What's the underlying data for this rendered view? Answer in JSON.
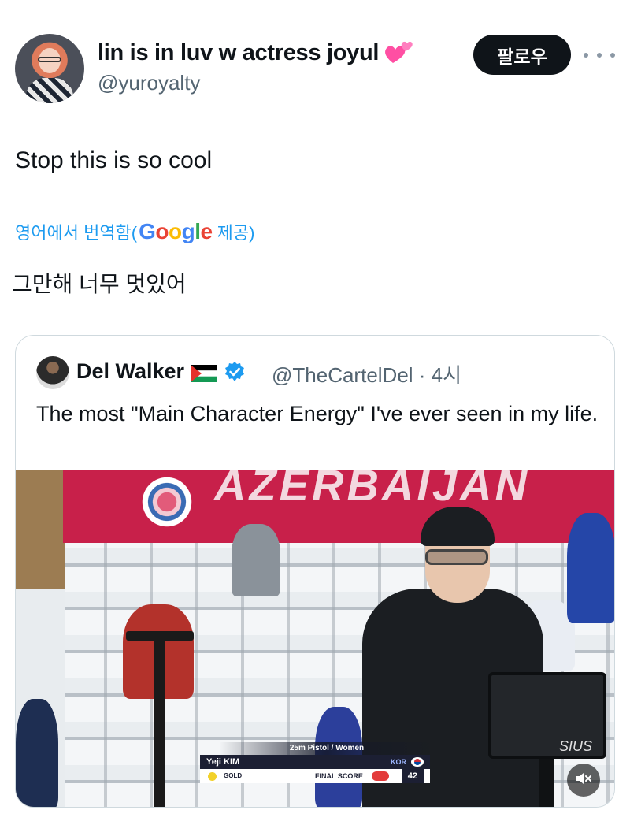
{
  "tweet": {
    "display_name": "lin is in luv w actress joyul",
    "handle": "@yuroyalty",
    "follow_label": "팔로우",
    "text": "Stop this is so cool",
    "translated_from": "영어에서 번역함(",
    "translation_provider": "Google",
    "translation_suffix": " 제공)",
    "translated_text": "그만해 너무 멋있어"
  },
  "quote": {
    "display_name": "Del Walker",
    "handle_time": "@TheCartelDel · 4시",
    "text": "The most \"Main Character Energy\" I've ever seen in my life."
  },
  "media": {
    "banner_text": "AZERBAIJAN",
    "event_label": "25m Pistol / Women",
    "athlete": "Yeji KIM",
    "country": "KOR",
    "medal": "GOLD",
    "final_label": "FINAL SCORE",
    "final_score": "42",
    "sponsor": "SIUS"
  },
  "icons": {
    "heart": "two-hearts-icon",
    "more": "more-icon",
    "verified": "verified-icon",
    "flag": "palestine-flag-icon",
    "mute": "mute-icon"
  },
  "colors": {
    "link": "#1d9bf0",
    "follow_bg": "#0f1419",
    "secondary_text": "#536471",
    "border": "#cfd9de"
  }
}
